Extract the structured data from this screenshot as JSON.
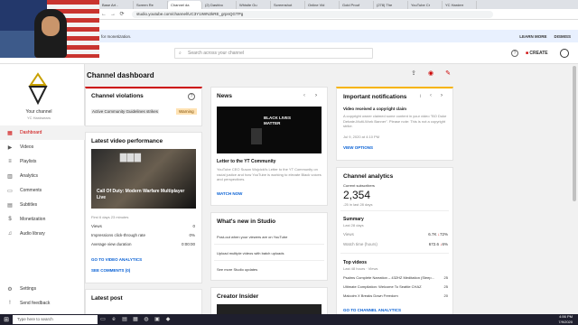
{
  "browser": {
    "tabs": [
      "Base Art -",
      "Screen Re",
      "Channel da",
      "(2) Dashbo",
      "Whistle Ou",
      "Screenshot",
      "Online Vid",
      "Gold Proof",
      "(278) The ",
      "YouTube Cr",
      "YC Harderr"
    ],
    "url": "studio.youtube.com/channel/UC3Y1IWN2kRE_grpnQGTPg"
  },
  "notice": {
    "message": "for monetization.",
    "learn_more": "LEARN MORE",
    "dismiss": "DISMISS"
  },
  "header": {
    "search_placeholder": "Search across your channel",
    "create_label": "CREATE"
  },
  "sidebar": {
    "channel_label": "Your channel",
    "channel_name": "YC Hardwears",
    "items": [
      {
        "label": "Dashboard",
        "icon": "dashboard-icon"
      },
      {
        "label": "Videos",
        "icon": "videos-icon"
      },
      {
        "label": "Playlists",
        "icon": "playlists-icon"
      },
      {
        "label": "Analytics",
        "icon": "analytics-icon"
      },
      {
        "label": "Comments",
        "icon": "comments-icon"
      },
      {
        "label": "Subtitles",
        "icon": "subtitles-icon"
      },
      {
        "label": "Monetization",
        "icon": "monetization-icon"
      },
      {
        "label": "Audio library",
        "icon": "audio-library-icon"
      }
    ],
    "settings": "Settings",
    "feedback": "Send feedback"
  },
  "dashboard": {
    "title": "Channel dashboard",
    "violations": {
      "title": "Channel violations",
      "rule": "Active Community Guidelines strikes",
      "status": "Warning"
    },
    "latest_video": {
      "title": "Latest video performance",
      "video_title": "Call Of Duty: Modern Warfare Multiplayer Live",
      "first_label": "First 6 days 23 minutes",
      "rows": [
        {
          "label": "Views",
          "value": "0"
        },
        {
          "label": "Impressions click-through rate",
          "value": "0%"
        },
        {
          "label": "Average view duration",
          "value": "0:00:00"
        }
      ],
      "go_to_analytics": "GO TO VIDEO ANALYTICS",
      "see_comments": "SEE COMMENTS (0)"
    },
    "latest_post": {
      "title": "Latest post"
    },
    "news": {
      "title": "News",
      "image_text": "BLACK LIVES MATTER",
      "headline": "Letter to the YT Community",
      "body": "YouTube CEO Susan Wojcicki's Letter to the YT Community on racial justice and how YouTube is working to elevate Black voices and perspectives.",
      "cta": "WATCH NOW"
    },
    "whats_new": {
      "title": "What's new in Studio",
      "items": [
        "Post-out when your viewers are on YouTube",
        "Upload multiple videos with batch uploads",
        "See more Studio updates"
      ]
    },
    "creator_insider": {
      "title": "Creator Insider"
    },
    "notifications": {
      "title": "Important notifications",
      "subtitle": "Video received a copyright claim",
      "body": "A copyright owner claimed some content in your video \"BO Duke Debate-Multi-Work Banner\". Please note: This is not a copyright strike.",
      "date": "Jul 9, 2020 at 4:10 PM",
      "cta": "VIEW OPTIONS"
    },
    "analytics": {
      "title": "Channel analytics",
      "subs_label": "Current subscribers",
      "subs_value": "2,354",
      "subs_delta": "-25 in last 28 days",
      "summary_title": "Summary",
      "summary_sub": "Last 28 days",
      "rows": [
        {
          "label": "Views",
          "value": "6.7K",
          "change": "72%"
        },
        {
          "label": "Watch time (hours)",
          "value": "672.6",
          "change": "6%"
        }
      ],
      "top_title": "Top videos",
      "top_sub": "Last 48 hours · Views",
      "top_videos": [
        {
          "title": "Psalms Complete Narration – 432HZ Meditation (Sleep...",
          "views": "25"
        },
        {
          "title": "Ultimate Compilation: Welcome To Seattle CHAZ",
          "views": "25"
        },
        {
          "title": "Malcolm X Breaks Down Freedom",
          "views": "20"
        }
      ],
      "cta": "GO TO CHANNEL ANALYTICS"
    }
  },
  "taskbar": {
    "search_placeholder": "Type here to search",
    "time": "4:56 PM",
    "date": "7/9/2020"
  },
  "colors": {
    "accent": "#cc0000",
    "link": "#065fd4",
    "warning": "#ffe2b3"
  }
}
